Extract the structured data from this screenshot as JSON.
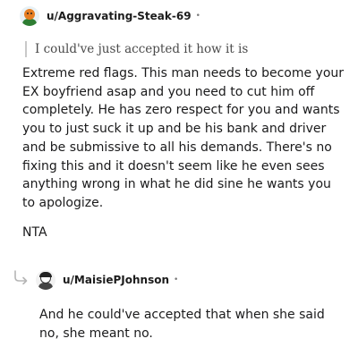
{
  "comment": {
    "username": "u/Aggravating-Steak-69",
    "dot": "•",
    "avatar_icon": "user-avatar-icon",
    "quote": "I could've just accepted it how it is",
    "body": "Extreme red flags. This man needs to become your EX boyfriend asap and you need to cut him off completely. He has zero respect for you and wants you to just suck it up and be his bank and driver and be submissive to all his demands. There's no fixing this and it doesn't seem like he even sees anything wrong in what he did sine he wants you to apologize.",
    "verdict": "NTA"
  },
  "reply": {
    "username": "u/MaisiePJohnson",
    "dot": "•",
    "avatar_icon": "user-avatar-icon",
    "reply_icon": "reply-arrow-icon",
    "body": "And he could've accepted that when she said no, she meant no."
  }
}
